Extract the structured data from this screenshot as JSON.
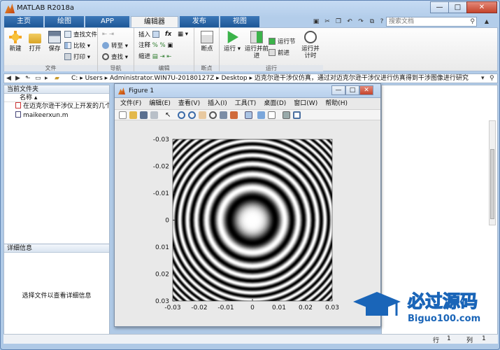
{
  "window": {
    "title": "MATLAB R2018a",
    "min": "—",
    "max": "□",
    "close": "✕"
  },
  "tabs": [
    {
      "label": "主页"
    },
    {
      "label": "绘图"
    },
    {
      "label": "APP"
    },
    {
      "label": "编辑器"
    },
    {
      "label": "发布"
    },
    {
      "label": "视图"
    }
  ],
  "search": {
    "placeholder": "搜索文档"
  },
  "ribbon": {
    "file_group": {
      "label": "文件",
      "new": "新建",
      "open": "打开",
      "save": "保存",
      "find_files": "查找文件",
      "compare": "比较",
      "print": "打印"
    },
    "nav_group": {
      "label": "导航",
      "goto": "转至",
      "find": "查找"
    },
    "edit_group": {
      "label": "编辑",
      "insert": "插入",
      "comment": "注释",
      "indent": "缩进",
      "fx": "fx"
    },
    "breakpoint_group": {
      "label": "断点",
      "breakpoints": "断点"
    },
    "run_group": {
      "label": "运行",
      "run": "运行",
      "run_advance": "运行并前进",
      "run_section": "运行节",
      "advance": "前进",
      "run_time": "运行并计时"
    }
  },
  "address": {
    "path": [
      "C:",
      "Users",
      "Administrator.WIN7U-20180127Z",
      "Desktop",
      "迈克尔逊干涉仪仿真，通过对迈克尔逊干涉仪进行仿真得到干涉图像进行研究"
    ]
  },
  "file_browser": {
    "title": "当前文件夹",
    "column": "名称",
    "items": [
      {
        "name": "在迈克尔逊干涉仪上开发的几个..."
      },
      {
        "name": "maikeerxun.m"
      }
    ],
    "details_title": "详细信息",
    "details_msg": "选择文件以查看详细信息"
  },
  "figure": {
    "title": "Figure 1",
    "menu": [
      "文件(F)",
      "编辑(E)",
      "查看(V)",
      "插入(I)",
      "工具(T)",
      "桌面(D)",
      "窗口(W)",
      "帮助(H)"
    ]
  },
  "chart_data": {
    "type": "heatmap",
    "description_of_values": "intensity = cos^2 of radial phase, concentric interference rings",
    "xlim": [
      -0.03,
      0.03
    ],
    "ylim": [
      -0.03,
      0.03
    ],
    "y_reversed": true,
    "x_ticks": [
      "-0.03",
      "-0.02",
      "-0.01",
      "0",
      "0.01",
      "0.02",
      "0.03"
    ],
    "y_ticks": [
      "-0.03",
      "-0.02",
      "-0.01",
      "0",
      "0.01",
      "0.02",
      "0.03"
    ],
    "colormap": "gray",
    "ring_count_to_edge": 6
  },
  "status": {
    "line_label": "行",
    "line_value": "1",
    "col_label": "列",
    "col_value": "1"
  },
  "watermark": {
    "title": "必过源码",
    "subtitle": "Biguo100.com"
  }
}
